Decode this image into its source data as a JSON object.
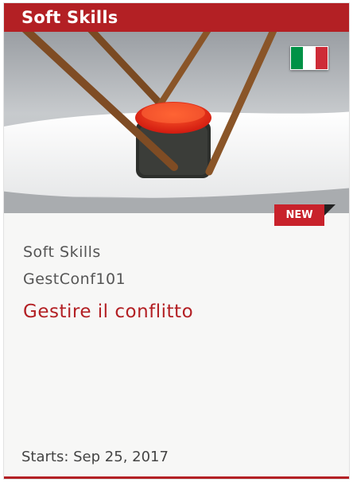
{
  "header": {
    "title": "Soft Skills"
  },
  "hero": {
    "flag_icon": "italy-flag-icon",
    "flag_colors": [
      "#009246",
      "#ffffff",
      "#ce2b37"
    ]
  },
  "badge": {
    "label": "NEW"
  },
  "course": {
    "category": "Soft Skills",
    "code": "GestConf101",
    "title": "Gestire il conflitto"
  },
  "footer": {
    "starts": "Starts: Sep 25, 2017"
  },
  "colors": {
    "accent": "#b32024",
    "badge": "#c8222b"
  }
}
